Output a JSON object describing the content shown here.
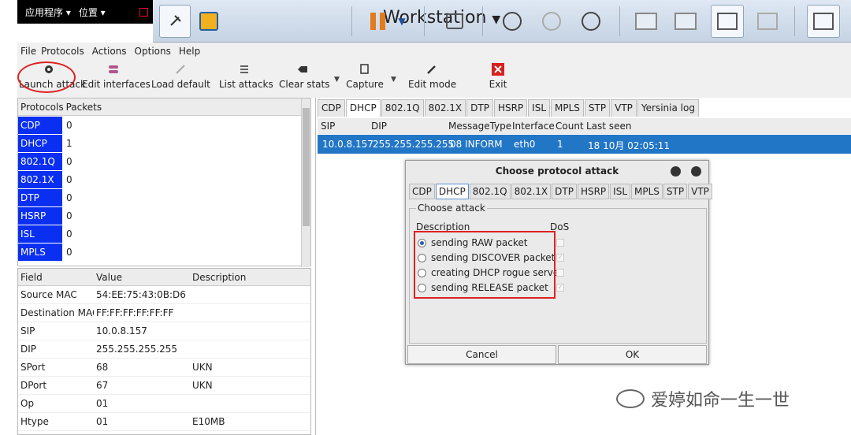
{
  "system_bar": {
    "apps": "应用程序 ▾",
    "places": "位置 ▾"
  },
  "vmware": {
    "title": "Workstation",
    "dropdown": "▼"
  },
  "menubar": [
    "File",
    "Protocols",
    "Actions",
    "Options",
    "Help"
  ],
  "toolbar": {
    "launch_attack": "Launch attack",
    "edit_interfaces": "Edit interfaces",
    "load_default": "Load default",
    "list_attacks": "List attacks",
    "clear_stats": "Clear stats",
    "capture": "Capture",
    "edit_mode": "Edit mode",
    "exit": "Exit"
  },
  "protocols_table": {
    "headers": [
      "Protocols",
      "Packets"
    ],
    "rows": [
      {
        "name": "CDP",
        "packets": "0"
      },
      {
        "name": "DHCP",
        "packets": "1"
      },
      {
        "name": "802.1Q",
        "packets": "0"
      },
      {
        "name": "802.1X",
        "packets": "0"
      },
      {
        "name": "DTP",
        "packets": "0"
      },
      {
        "name": "HSRP",
        "packets": "0"
      },
      {
        "name": "ISL",
        "packets": "0"
      },
      {
        "name": "MPLS",
        "packets": "0"
      }
    ]
  },
  "fields_table": {
    "headers": [
      "Field",
      "Value",
      "Description"
    ],
    "rows": [
      {
        "field": "Source MAC",
        "value": "54:EE:75:43:0B:D6",
        "desc": ""
      },
      {
        "field": "Destination MAC",
        "value": "FF:FF:FF:FF:FF:FF",
        "desc": ""
      },
      {
        "field": "SIP",
        "value": "10.0.8.157",
        "desc": ""
      },
      {
        "field": "DIP",
        "value": "255.255.255.255",
        "desc": ""
      },
      {
        "field": "SPort",
        "value": "68",
        "desc": "UKN"
      },
      {
        "field": "DPort",
        "value": "67",
        "desc": "UKN"
      },
      {
        "field": "Op",
        "value": "01",
        "desc": ""
      },
      {
        "field": "Htype",
        "value": "01",
        "desc": "E10MB"
      }
    ]
  },
  "proto_tabs": [
    "CDP",
    "DHCP",
    "802.1Q",
    "802.1X",
    "DTP",
    "HSRP",
    "ISL",
    "MPLS",
    "STP",
    "VTP",
    "Yersinia log"
  ],
  "packet_table": {
    "headers": [
      "SIP",
      "DIP",
      "MessageType",
      "Interface",
      "Count",
      "Last seen"
    ],
    "row": {
      "sip": "10.0.8.157",
      "dip": "255.255.255.255",
      "msg": "08 INFORM",
      "iface": "eth0",
      "count": "1",
      "last_seen": "18 10月 02:05:11"
    }
  },
  "dialog": {
    "title": "Choose protocol attack",
    "tabs": [
      "CDP",
      "DHCP",
      "802.1Q",
      "802.1X",
      "DTP",
      "HSRP",
      "ISL",
      "MPLS",
      "STP",
      "VTP"
    ],
    "group_label": "Choose attack",
    "desc_header": "Description",
    "dos_header": "DoS",
    "options": [
      {
        "label": "sending RAW packet",
        "selected": true,
        "dos": false
      },
      {
        "label": "sending DISCOVER packet",
        "selected": false,
        "dos": true
      },
      {
        "label": "creating DHCP rogue server",
        "selected": false,
        "dos": false
      },
      {
        "label": "sending RELEASE packet",
        "selected": false,
        "dos": true
      }
    ],
    "cancel": "Cancel",
    "ok": "OK"
  },
  "watermark": {
    "text": "爱婷如命一生一世"
  }
}
